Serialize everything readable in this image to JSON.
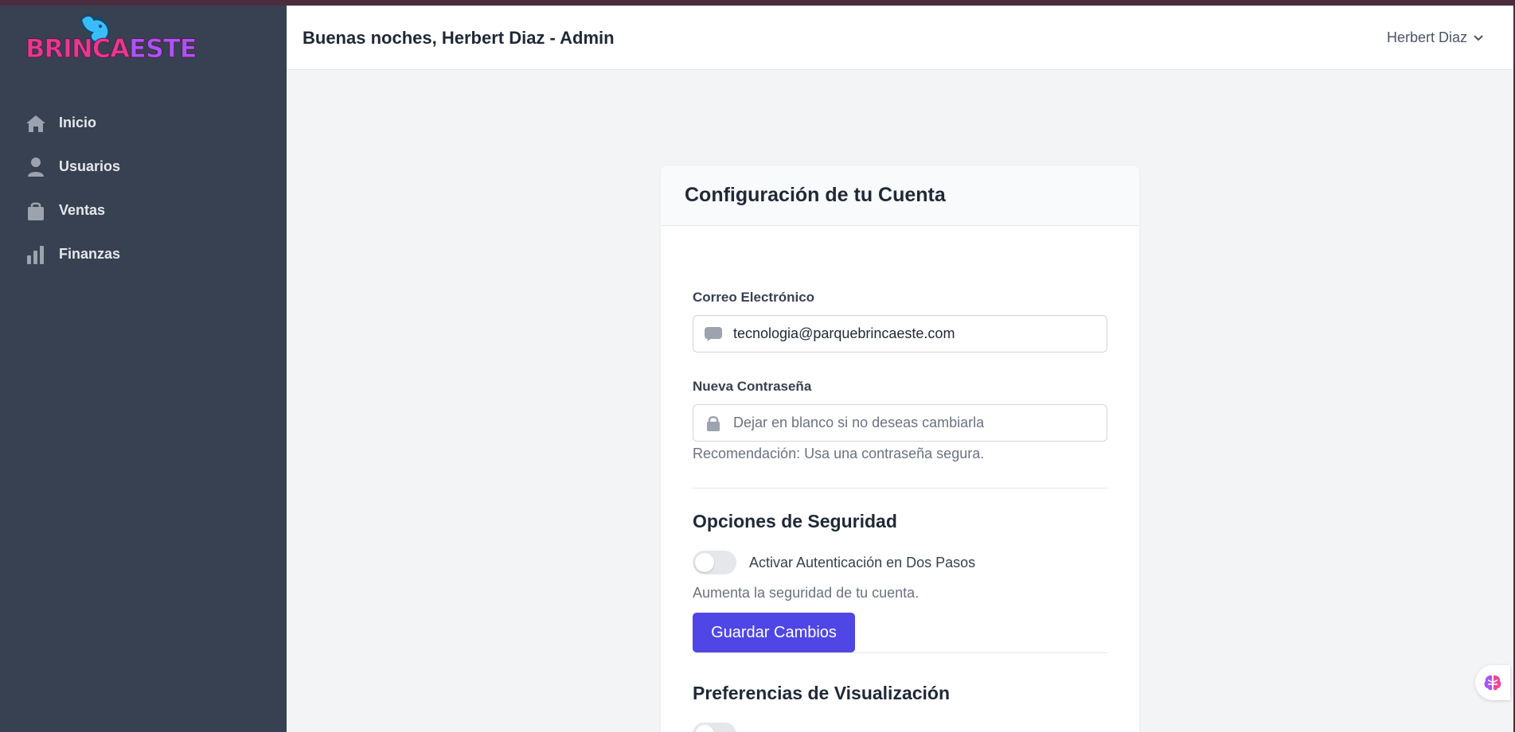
{
  "app": {
    "logo_text_1": "BRINCA",
    "logo_text_2": "ESTE"
  },
  "header": {
    "greeting": "Buenas noches, Herbert Diaz - Admin",
    "user_name": "Herbert Diaz"
  },
  "sidebar": {
    "items": [
      {
        "label": "Inicio",
        "icon": "home-icon"
      },
      {
        "label": "Usuarios",
        "icon": "user-icon"
      },
      {
        "label": "Ventas",
        "icon": "shopping-bag-icon"
      },
      {
        "label": "Finanzas",
        "icon": "bar-chart-icon"
      }
    ]
  },
  "account": {
    "title": "Configuración de tu Cuenta",
    "email_label": "Correo Electrónico",
    "email_value": "tecnologia@parquebrincaeste.com",
    "password_label": "Nueva Contraseña",
    "password_placeholder": "Dejar en blanco si no deseas cambiarla",
    "password_hint": "Recomendación: Usa una contraseña segura.",
    "security_title": "Opciones de Seguridad",
    "two_factor_label": "Activar Autenticación en Dos Pasos",
    "two_factor_enabled": false,
    "security_hint": "Aumenta la seguridad de tu cuenta.",
    "save_label": "Guardar Cambios",
    "display_title": "Preferencias de Visualización"
  },
  "colors": {
    "sidebar": "#374151",
    "accent": "#4f46e5",
    "brand_pink": "#e8388f"
  }
}
